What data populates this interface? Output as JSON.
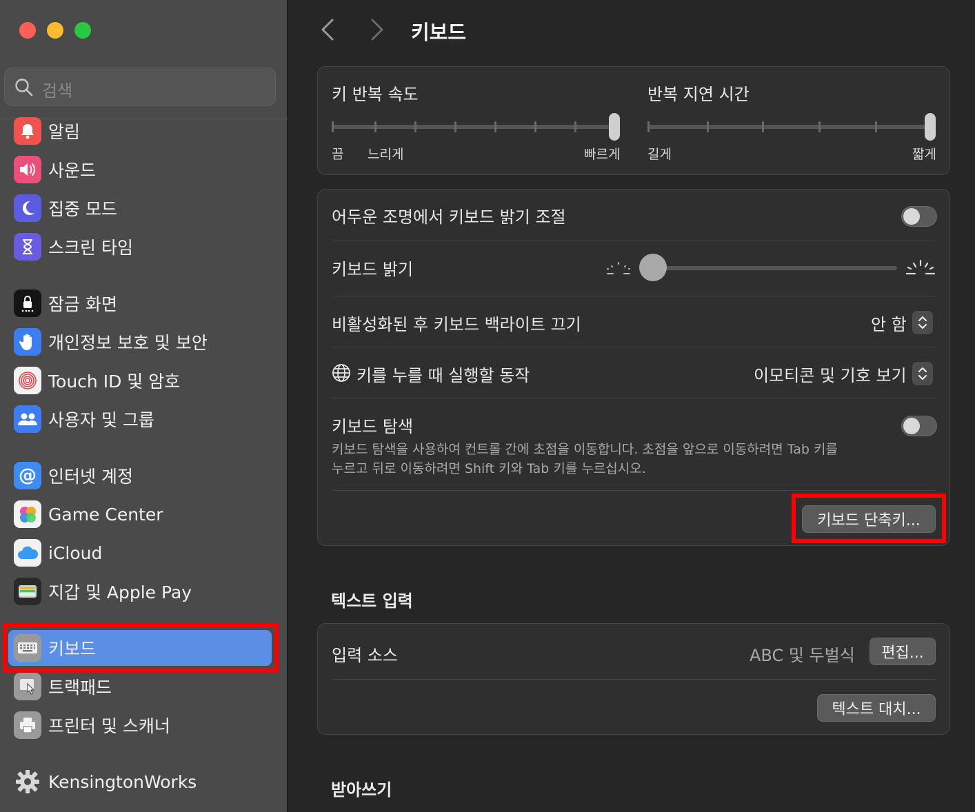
{
  "window": {
    "traffic_lights": {
      "close": "#fe5f57",
      "minimize": "#febc2e",
      "zoom": "#28c840"
    }
  },
  "sidebar": {
    "search_placeholder": "검색",
    "items": [
      {
        "label": "알림",
        "icon": "bell-icon",
        "color": "#f0524e"
      },
      {
        "label": "사운드",
        "icon": "speaker-icon",
        "color": "#ec4f79"
      },
      {
        "label": "집중 모드",
        "icon": "moon-icon",
        "color": "#5c5ce0"
      },
      {
        "label": "스크린 타임",
        "icon": "hourglass-icon",
        "color": "#6a5ce0"
      },
      {
        "label": "잠금 화면",
        "icon": "lock-icon",
        "color": "#141414"
      },
      {
        "label": "개인정보 보호 및 보안",
        "icon": "hand-icon",
        "color": "#3d7df2"
      },
      {
        "label": "Touch ID 및 암호",
        "icon": "fingerprint-icon",
        "color": "#f2f2f2"
      },
      {
        "label": "사용자 및 그룹",
        "icon": "users-icon",
        "color": "#3d7df2"
      },
      {
        "label": "인터넷 계정",
        "icon": "at-icon",
        "color": "#3d8cf2"
      },
      {
        "label": "Game Center",
        "icon": "game-center-icon",
        "color": "#f2f2f2"
      },
      {
        "label": "iCloud",
        "icon": "cloud-icon",
        "color": "#f2f2f2"
      },
      {
        "label": "지갑 및 Apple Pay",
        "icon": "wallet-icon",
        "color": "#2a2a2a"
      },
      {
        "label": "키보드",
        "icon": "keyboard-icon",
        "color": "#9a9a9a"
      },
      {
        "label": "트랙패드",
        "icon": "trackpad-icon",
        "color": "#9a9a9a"
      },
      {
        "label": "프린터 및 스캐너",
        "icon": "printer-icon",
        "color": "#9a9a9a"
      },
      {
        "label": "KensingtonWorks",
        "icon": "gear-icon",
        "color": "#4a4a4a"
      }
    ],
    "selected_color": "#5b8fe6"
  },
  "header": {
    "title": "키보드"
  },
  "repeat": {
    "rate_label": "키 반복 속도",
    "rate_off": "끔",
    "rate_slow": "느리게",
    "rate_fast": "빠르게",
    "delay_label": "반복 지연 시간",
    "delay_long": "길게",
    "delay_short": "짧게"
  },
  "settings": {
    "auto_brightness_label": "어두운 조명에서 키보드 밝기 조절",
    "auto_brightness_on": false,
    "brightness_label": "키보드 밝기",
    "brightness_level": 0,
    "backlight_off_label": "비활성화된 후 키보드 백라이트 끄기",
    "backlight_off_value": "안 함",
    "globe_label": "키를 누를 때 실행할 동작",
    "globe_value": "이모티콘 및 기호 보기",
    "nav_label": "키보드 탐색",
    "nav_desc_line1": "키보드 탐색을 사용하여 컨트롤 간에 초점을 이동합니다. 초점을 앞으로 이동하려면 Tab 키를",
    "nav_desc_line2": "누르고 뒤로 이동하려면 Shift 키와 Tab 키를 누르십시오.",
    "nav_on": false,
    "shortcuts_button": "키보드 단축키..."
  },
  "text_input": {
    "heading": "텍스트 입력",
    "source_label": "입력 소스",
    "source_value": "ABC 및 두벌식",
    "edit_button": "편집...",
    "replace_button": "텍스트 대치..."
  },
  "dictation": {
    "heading": "받아쓰기"
  },
  "highlight_color": "#ff0000"
}
